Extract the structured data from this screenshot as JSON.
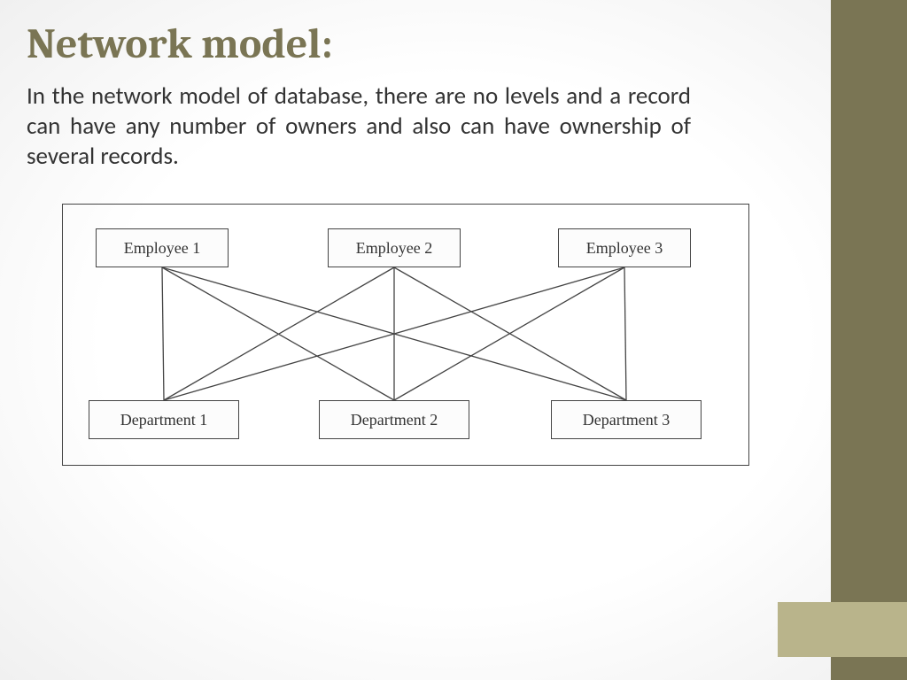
{
  "slide": {
    "title": "Network model:",
    "body": "In the network model of database, there are no levels and a record can have any number of owners and also can have ownership of several records."
  },
  "diagram": {
    "top_nodes": [
      {
        "id": "emp1",
        "label": "Employee 1"
      },
      {
        "id": "emp2",
        "label": "Employee 2"
      },
      {
        "id": "emp3",
        "label": "Employee 3"
      }
    ],
    "bottom_nodes": [
      {
        "id": "dept1",
        "label": "Department 1"
      },
      {
        "id": "dept2",
        "label": "Department 2"
      },
      {
        "id": "dept3",
        "label": "Department 3"
      }
    ],
    "edges": [
      [
        "emp1",
        "dept1"
      ],
      [
        "emp1",
        "dept2"
      ],
      [
        "emp1",
        "dept3"
      ],
      [
        "emp2",
        "dept1"
      ],
      [
        "emp2",
        "dept2"
      ],
      [
        "emp2",
        "dept3"
      ],
      [
        "emp3",
        "dept1"
      ],
      [
        "emp3",
        "dept2"
      ],
      [
        "emp3",
        "dept3"
      ]
    ]
  },
  "theme": {
    "accent_dark": "#7a7554",
    "accent_light": "#b9b48b"
  }
}
